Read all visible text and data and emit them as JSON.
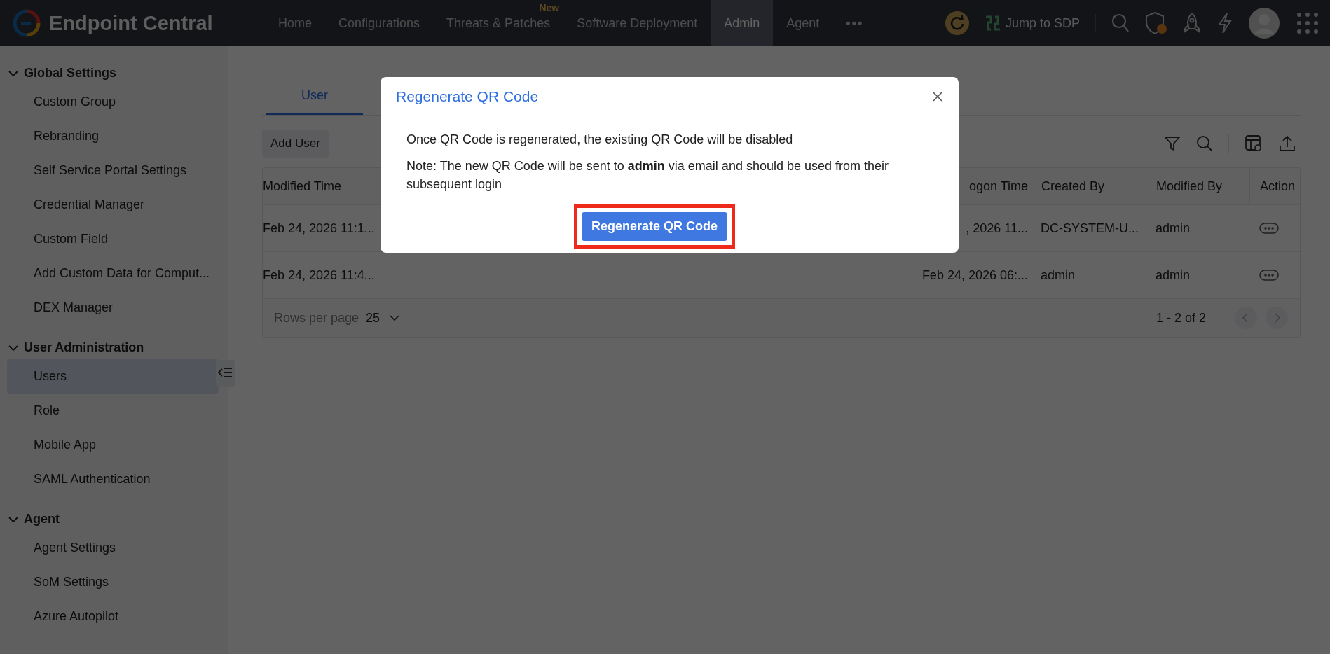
{
  "header": {
    "brand": "Endpoint Central",
    "nav": [
      {
        "label": "Home",
        "selected": false
      },
      {
        "label": "Configurations",
        "selected": false
      },
      {
        "label": "Threats & Patches",
        "selected": false,
        "badge": "New"
      },
      {
        "label": "Software Deployment",
        "selected": false
      },
      {
        "label": "Admin",
        "selected": true
      },
      {
        "label": "Agent",
        "selected": false
      }
    ],
    "more": "•••",
    "jump_link": "Jump to SDP"
  },
  "sidebar": {
    "groups": [
      {
        "title": "Global Settings",
        "expanded": true,
        "items": [
          {
            "label": "Custom Group",
            "selected": false
          },
          {
            "label": "Rebranding",
            "selected": false
          },
          {
            "label": "Self Service Portal Settings",
            "selected": false
          },
          {
            "label": "Credential Manager",
            "selected": false
          },
          {
            "label": "Custom Field",
            "selected": false
          },
          {
            "label": "Add Custom Data for Comput...",
            "selected": false
          },
          {
            "label": "DEX Manager",
            "selected": false
          }
        ]
      },
      {
        "title": "User Administration",
        "expanded": true,
        "items": [
          {
            "label": "Users",
            "selected": true
          },
          {
            "label": "Role",
            "selected": false
          },
          {
            "label": "Mobile App",
            "selected": false
          },
          {
            "label": "SAML Authentication",
            "selected": false
          }
        ]
      },
      {
        "title": "Agent",
        "expanded": true,
        "items": [
          {
            "label": "Agent Settings",
            "selected": false
          },
          {
            "label": "SoM Settings",
            "selected": false
          },
          {
            "label": "Azure Autopilot",
            "selected": false
          }
        ]
      }
    ]
  },
  "tabs": [
    {
      "label": "User",
      "selected": true
    }
  ],
  "add_button": "Add User",
  "table": {
    "columns": {
      "modified_time": "Modified Time",
      "last_logon": "ogon Time",
      "created_by": "Created By",
      "modified_by": "Modified By",
      "action": "Action"
    },
    "rows": [
      {
        "modified_time": "Feb 24, 2026 11:1...",
        "last_logon": ", 2026 11...",
        "created_by": "DC-SYSTEM-U...",
        "modified_by": "admin"
      },
      {
        "modified_time": "Feb 24, 2026 11:4...",
        "last_logon": "Feb 24, 2026 06:...",
        "created_by": "admin",
        "modified_by": "admin"
      }
    ],
    "rows_per_page_label": "Rows per page",
    "rows_per_page": "25",
    "range": "1 - 2 of 2"
  },
  "dialog": {
    "title": "Regenerate QR Code",
    "message": "Once QR Code is regenerated, the existing QR Code will be disabled",
    "note": "Note: The new QR Code will be sent to **admin** via email and should be used from their subsequent login",
    "button": "Regenerate QR Code",
    "button_highlighted": true
  }
}
